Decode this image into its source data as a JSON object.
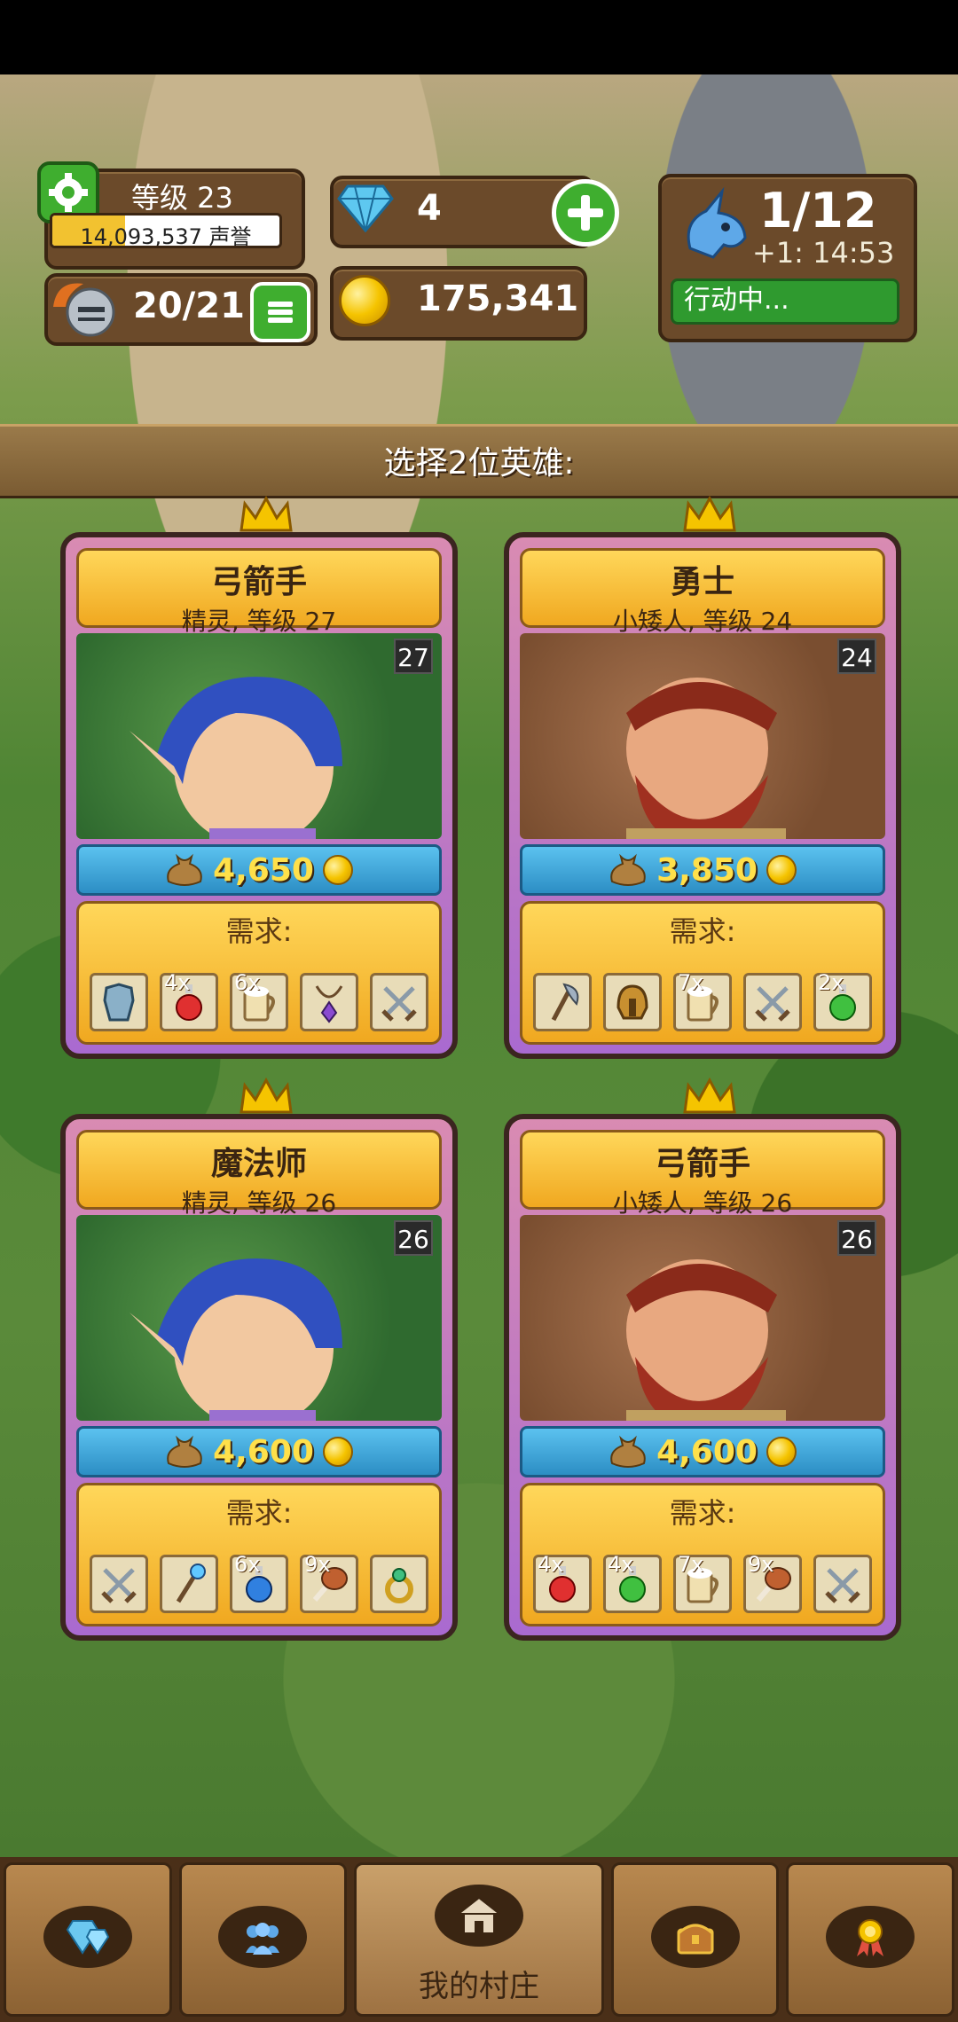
{
  "hud": {
    "level": "等级 23",
    "reputation": "14,093,537 声誉",
    "reputation_progress": 0.32,
    "heroes": "20/21",
    "gems": "4",
    "gold": "175,341",
    "actions": "1/12",
    "actions_timer": "+1: 14:53",
    "actions_status": "行动中..."
  },
  "banner": {
    "text": "选择2位英雄:"
  },
  "heroes": [
    {
      "title": "弓箭手",
      "subtitle": "精灵, 等级 27",
      "level": "27",
      "race": "elf",
      "price": "4,650",
      "needs_label": "需求:",
      "requirements": [
        {
          "icon": "armor-icon",
          "qty": ""
        },
        {
          "icon": "red-potion-icon",
          "qty": "4x"
        },
        {
          "icon": "beer-mug-icon",
          "qty": "6x"
        },
        {
          "icon": "amulet-icon",
          "qty": ""
        },
        {
          "icon": "crossed-swords-icon",
          "qty": ""
        }
      ]
    },
    {
      "title": "勇士",
      "subtitle": "小矮人, 等级 24",
      "level": "24",
      "race": "dwarf",
      "price": "3,850",
      "needs_label": "需求:",
      "requirements": [
        {
          "icon": "axe-icon",
          "qty": ""
        },
        {
          "icon": "helmet-icon",
          "qty": ""
        },
        {
          "icon": "beer-mug-icon",
          "qty": "7x"
        },
        {
          "icon": "crossed-swords-icon",
          "qty": ""
        },
        {
          "icon": "green-potion-icon",
          "qty": "2x"
        }
      ]
    },
    {
      "title": "魔法师",
      "subtitle": "精灵, 等级 26",
      "level": "26",
      "race": "elf",
      "price": "4,600",
      "needs_label": "需求:",
      "requirements": [
        {
          "icon": "crossed-swords-icon",
          "qty": ""
        },
        {
          "icon": "magic-staff-icon",
          "qty": ""
        },
        {
          "icon": "blue-potion-icon",
          "qty": "6x"
        },
        {
          "icon": "meat-icon",
          "qty": "9x"
        },
        {
          "icon": "ring-icon",
          "qty": ""
        }
      ]
    },
    {
      "title": "弓箭手",
      "subtitle": "小矮人, 等级 26",
      "level": "26",
      "race": "dwarf",
      "price": "4,600",
      "needs_label": "需求:",
      "requirements": [
        {
          "icon": "red-potion-icon",
          "qty": "4x"
        },
        {
          "icon": "green-potion-icon",
          "qty": "4x"
        },
        {
          "icon": "beer-mug-icon",
          "qty": "7x"
        },
        {
          "icon": "meat-icon",
          "qty": "9x"
        },
        {
          "icon": "crossed-swords-icon",
          "qty": ""
        }
      ]
    }
  ],
  "nav": {
    "tabs": [
      {
        "icon": "gems-icon",
        "label": ""
      },
      {
        "icon": "people-icon",
        "label": ""
      },
      {
        "icon": "village-icon",
        "label": "我的村庄"
      },
      {
        "icon": "chest-icon",
        "label": ""
      },
      {
        "icon": "medal-icon",
        "label": ""
      }
    ]
  },
  "colors": {
    "accent_green": "#3fae2f",
    "gold": "#f5c400",
    "card_frame": "#a96ad0",
    "panel_brown": "#6b4a2a"
  }
}
